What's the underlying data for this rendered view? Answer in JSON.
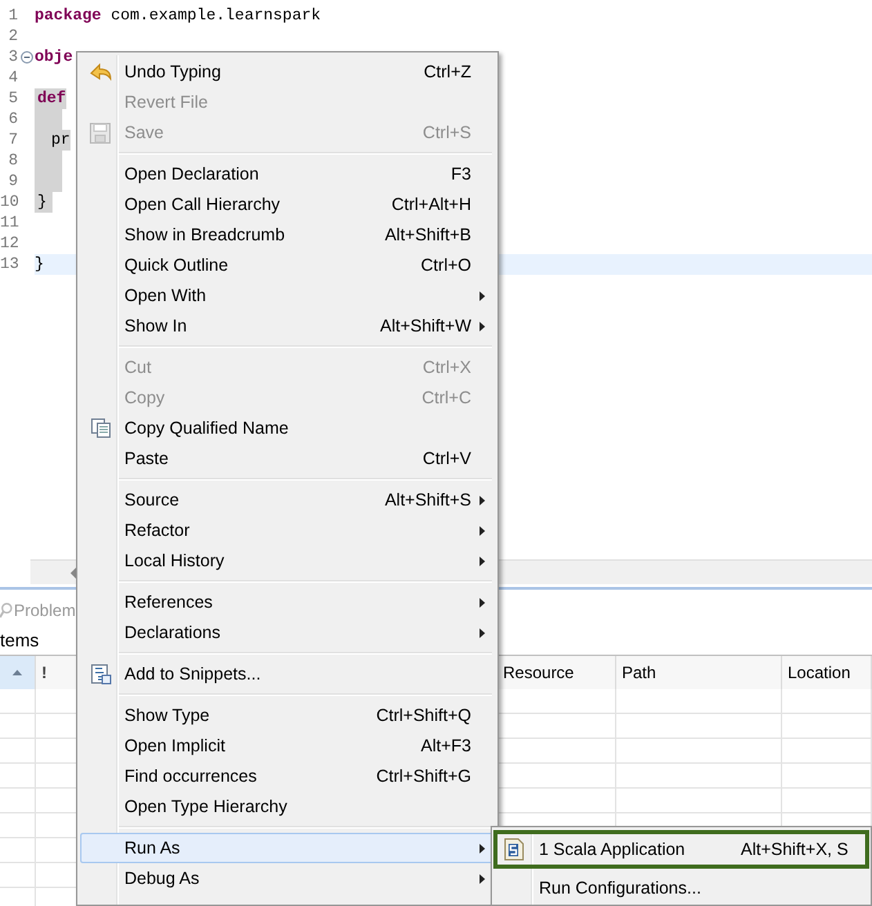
{
  "editor": {
    "lines": [
      {
        "number": "1",
        "keyword": "package",
        "text": " com.example.learnspark",
        "selected": false,
        "current": false
      },
      {
        "number": "2",
        "selected": false,
        "current": false
      },
      {
        "number": "3",
        "keyword": "obje",
        "folding": true,
        "selected": false,
        "current": false
      },
      {
        "number": "4",
        "selected": false,
        "current": false
      },
      {
        "number": "5",
        "keyword": "def",
        "selected": true,
        "current": false
      },
      {
        "number": "6",
        "selected": true,
        "current": false
      },
      {
        "number": "7",
        "text": "pr",
        "selected": true,
        "current": false
      },
      {
        "number": "8",
        "selected": true,
        "current": false
      },
      {
        "number": "9",
        "selected": true,
        "current": false
      },
      {
        "number": "10",
        "text": "}",
        "selected": true,
        "current": false
      },
      {
        "number": "11",
        "selected": false,
        "current": false
      },
      {
        "number": "12",
        "selected": false,
        "current": false
      },
      {
        "number": "13",
        "text": "}",
        "selected": false,
        "current": true
      }
    ]
  },
  "problems_panel": {
    "tab": "Problem",
    "summary": "tems",
    "columns": [
      {
        "sorted": true
      },
      {
        "label": "!",
        "sorted": false
      },
      {
        "label": "Resource",
        "sorted": false
      },
      {
        "label": "Path",
        "sorted": false
      },
      {
        "label": "Location",
        "sorted": false
      }
    ]
  },
  "context_menu": {
    "items": [
      {
        "kind": "item",
        "label": "Undo Typing",
        "shortcut": "Ctrl+Z",
        "disabled": false,
        "selected": false
      },
      {
        "kind": "item",
        "label": "Revert File",
        "disabled": true,
        "selected": false
      },
      {
        "kind": "item",
        "label": "Save",
        "shortcut": "Ctrl+S",
        "disabled": true,
        "selected": false
      },
      {
        "kind": "separator"
      },
      {
        "kind": "item",
        "label": "Open Declaration",
        "shortcut": "F3",
        "disabled": false,
        "selected": false
      },
      {
        "kind": "item",
        "label": "Open Call Hierarchy",
        "shortcut": "Ctrl+Alt+H",
        "disabled": false,
        "selected": false
      },
      {
        "kind": "item",
        "label": "Show in Breadcrumb",
        "shortcut": "Alt+Shift+B",
        "disabled": false,
        "selected": false
      },
      {
        "kind": "item",
        "label": "Quick Outline",
        "shortcut": "Ctrl+O",
        "disabled": false,
        "selected": false
      },
      {
        "kind": "item",
        "label": "Open With",
        "submenu": true,
        "disabled": false,
        "selected": false
      },
      {
        "kind": "item",
        "label": "Show In",
        "shortcut": "Alt+Shift+W",
        "submenu": true,
        "disabled": false,
        "selected": false
      },
      {
        "kind": "separator"
      },
      {
        "kind": "item",
        "label": "Cut",
        "shortcut": "Ctrl+X",
        "disabled": true,
        "selected": false
      },
      {
        "kind": "item",
        "label": "Copy",
        "shortcut": "Ctrl+C",
        "disabled": true,
        "selected": false
      },
      {
        "kind": "item",
        "label": "Copy Qualified Name",
        "disabled": false,
        "selected": false
      },
      {
        "kind": "item",
        "label": "Paste",
        "shortcut": "Ctrl+V",
        "disabled": false,
        "selected": false
      },
      {
        "kind": "separator"
      },
      {
        "kind": "item",
        "label": "Source",
        "shortcut": "Alt+Shift+S",
        "submenu": true,
        "disabled": false,
        "selected": false
      },
      {
        "kind": "item",
        "label": "Refactor",
        "submenu": true,
        "disabled": false,
        "selected": false
      },
      {
        "kind": "item",
        "label": "Local History",
        "submenu": true,
        "disabled": false,
        "selected": false
      },
      {
        "kind": "separator"
      },
      {
        "kind": "item",
        "label": "References",
        "submenu": true,
        "disabled": false,
        "selected": false
      },
      {
        "kind": "item",
        "label": "Declarations",
        "submenu": true,
        "disabled": false,
        "selected": false
      },
      {
        "kind": "separator"
      },
      {
        "kind": "item",
        "label": "Add to Snippets...",
        "disabled": false,
        "selected": false
      },
      {
        "kind": "separator"
      },
      {
        "kind": "item",
        "label": "Show Type",
        "shortcut": "Ctrl+Shift+Q",
        "disabled": false,
        "selected": false
      },
      {
        "kind": "item",
        "label": "Open Implicit",
        "shortcut": "Alt+F3",
        "disabled": false,
        "selected": false
      },
      {
        "kind": "item",
        "label": "Find occurrences",
        "shortcut": "Ctrl+Shift+G",
        "disabled": false,
        "selected": false
      },
      {
        "kind": "item",
        "label": "Open Type Hierarchy",
        "disabled": false,
        "selected": false
      },
      {
        "kind": "separator"
      },
      {
        "kind": "item",
        "label": "Run As",
        "submenu": true,
        "disabled": false,
        "selected": true
      },
      {
        "kind": "item",
        "label": "Debug As",
        "submenu": true,
        "disabled": false,
        "selected": false
      }
    ]
  },
  "run_as_submenu": {
    "items": [
      {
        "label": "1 Scala Application",
        "shortcut": "Alt+Shift+X, S",
        "outlined": true,
        "selected": false
      },
      {
        "label": "Run Configurations...",
        "outlined": false,
        "selected": false
      }
    ]
  }
}
